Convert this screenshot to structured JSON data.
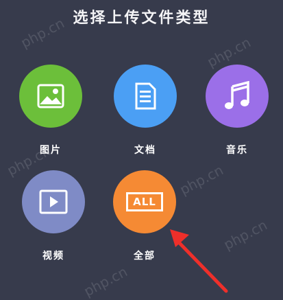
{
  "title": "选择上传文件类型",
  "items": [
    {
      "label": "图片",
      "color": "#6cbf3a",
      "icon": "image-icon"
    },
    {
      "label": "文档",
      "color": "#4b9ff4",
      "icon": "document-icon"
    },
    {
      "label": "音乐",
      "color": "#9b6fe8",
      "icon": "music-note-icon"
    },
    {
      "label": "视频",
      "color": "#7f8bc6",
      "icon": "video-play-icon"
    },
    {
      "label": "全部",
      "color": "#f58a34",
      "icon": "all-icon",
      "icon_text": "ALL"
    }
  ],
  "watermark": "php.cn",
  "annotation_arrow_color": "#ee2f2a"
}
